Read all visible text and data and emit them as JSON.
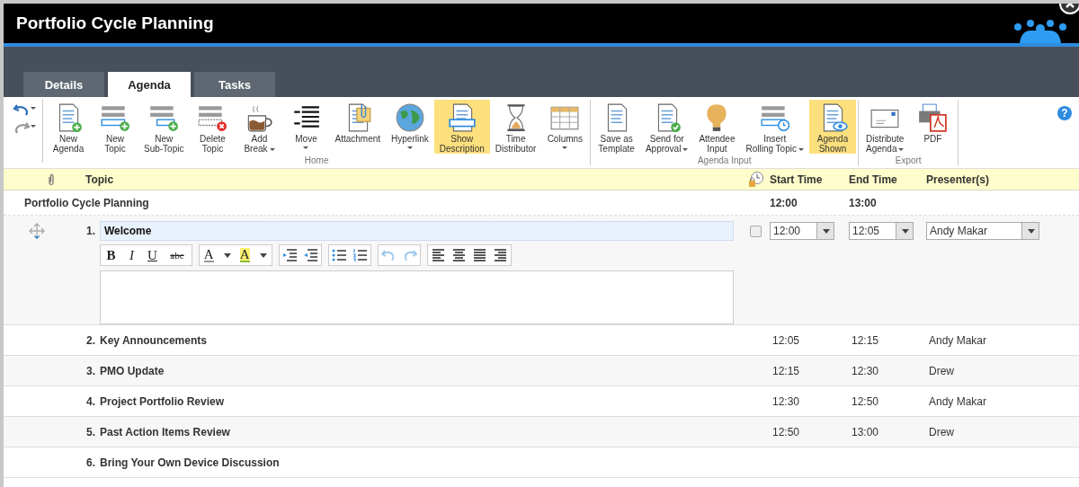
{
  "window": {
    "title": "Portfolio Cycle Planning"
  },
  "tabs": [
    {
      "label": "Details",
      "selected": false
    },
    {
      "label": "Agenda",
      "selected": true
    },
    {
      "label": "Tasks",
      "selected": false
    }
  ],
  "ribbon": {
    "groups": [
      {
        "label": "Home",
        "buttons": [
          {
            "label": "New\nAgenda",
            "highlighted": false
          },
          {
            "label": "New\nTopic",
            "highlighted": false
          },
          {
            "label": "New\nSub-Topic",
            "highlighted": false
          },
          {
            "label": "Delete\nTopic",
            "highlighted": false
          },
          {
            "label": "Add\nBreak",
            "dropdown": true,
            "caret_below": false,
            "highlighted": false
          },
          {
            "label": "Move",
            "dropdown": true,
            "caret_below": true,
            "highlighted": false
          },
          {
            "label": "Attachment",
            "highlighted": false
          },
          {
            "label": "Hyperlink",
            "dropdown": true,
            "caret_below": true,
            "highlighted": false
          },
          {
            "label": "Show\nDescription",
            "highlighted": true
          },
          {
            "label": "Time\nDistributor",
            "highlighted": false
          },
          {
            "label": "Columns",
            "dropdown": true,
            "caret_below": true,
            "highlighted": false
          }
        ]
      },
      {
        "label": "Agenda Input",
        "buttons": [
          {
            "label": "Save as\nTemplate",
            "highlighted": false
          },
          {
            "label": "Send for\nApproval",
            "dropdown": true,
            "caret_below": false,
            "highlighted": false
          },
          {
            "label": "Attendee\nInput",
            "highlighted": false
          },
          {
            "label": "Insert\nRolling Topic",
            "dropdown": true,
            "caret_below": false,
            "highlighted": false
          },
          {
            "label": "Agenda\nShown",
            "highlighted": true
          }
        ]
      },
      {
        "label": "Export",
        "buttons": [
          {
            "label": "Distribute\nAgenda",
            "dropdown": true,
            "caret_below": false,
            "highlighted": false
          },
          {
            "label": "PDF",
            "highlighted": false
          }
        ]
      }
    ],
    "help": "?"
  },
  "table": {
    "columns": {
      "topic": "Topic",
      "start": "Start Time",
      "end": "End Time",
      "presenter": "Presenter(s)"
    },
    "agenda": {
      "title": "Portfolio Cycle Planning",
      "start": "12:00",
      "end": "13:00"
    },
    "editing": {
      "number": "1.",
      "topic": "Welcome",
      "time_locked": false,
      "start": "12:00",
      "end": "12:05",
      "presenter": "Andy Makar",
      "format": {
        "text_buttons": [
          "B",
          "I",
          "U",
          "abc"
        ],
        "font_color": "A",
        "highlight": "A"
      }
    },
    "rows": [
      {
        "number": "2.",
        "topic": "Key Announcements",
        "start": "12:05",
        "end": "12:15",
        "presenter": "Andy Makar"
      },
      {
        "number": "3.",
        "topic": "PMO Update",
        "start": "12:15",
        "end": "12:30",
        "presenter": "Drew"
      },
      {
        "number": "4.",
        "topic": "Project Portfolio Review",
        "start": "12:30",
        "end": "12:50",
        "presenter": "Andy Makar"
      },
      {
        "number": "5.",
        "topic": "Past Action Items Review",
        "start": "12:50",
        "end": "13:00",
        "presenter": "Drew"
      },
      {
        "number": "6.",
        "topic": "Bring Your Own Device Discussion"
      }
    ]
  }
}
